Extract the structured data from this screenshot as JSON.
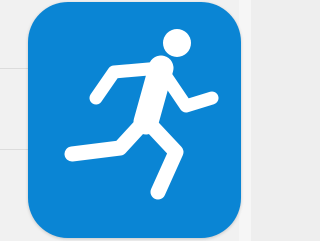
{
  "app_icon": {
    "name": "running-person-icon",
    "background_color": "#0a85d4",
    "glyph_color": "#ffffff"
  }
}
